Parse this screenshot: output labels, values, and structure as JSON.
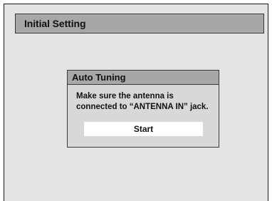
{
  "header": {
    "title": "Initial Setting"
  },
  "dialog": {
    "title": "Auto Tuning",
    "message_line1": "Make sure the antenna is",
    "message_line2": "connected to “ANTENNA IN” jack.",
    "start_label": "Start"
  },
  "colors": {
    "background": "#e4e4e4",
    "title_bar": "#a7a7a7",
    "dialog_body": "#d8d8d8",
    "button": "#ffffff",
    "text": "#111111"
  }
}
